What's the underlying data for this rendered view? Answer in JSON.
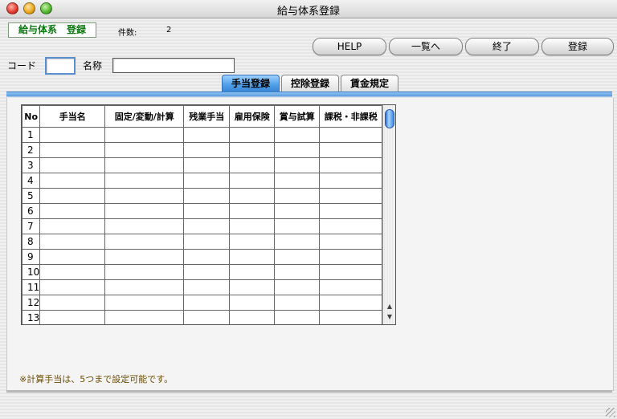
{
  "window": {
    "title": "給与体系登録"
  },
  "header": {
    "module_label": "給与体系　登録",
    "count_label": "件数:",
    "count_value": "2"
  },
  "toolbar": {
    "help_label": "HELP",
    "list_label": "一覧へ",
    "exit_label": "終了",
    "register_label": "登録"
  },
  "form": {
    "code_label": "コード",
    "code_value": "",
    "name_label": "名称",
    "name_value": ""
  },
  "tabs": [
    {
      "label": "手当登録",
      "active": true
    },
    {
      "label": "控除登録",
      "active": false
    },
    {
      "label": "賃金規定",
      "active": false
    }
  ],
  "table": {
    "columns": [
      "No",
      "手当名",
      "固定/変動/計算",
      "残業手当",
      "雇用保険",
      "賞与試算",
      "課税・非課税"
    ],
    "rows": [
      "1",
      "2",
      "3",
      "4",
      "5",
      "6",
      "7",
      "8",
      "9",
      "10",
      "11",
      "12",
      "13"
    ]
  },
  "notice": "※計算手当は、5つまで設定可能です。",
  "colors": {
    "accent_tab": "#4d9ee8",
    "module_text": "#0a7a10",
    "notice_text": "#6b4c00"
  }
}
